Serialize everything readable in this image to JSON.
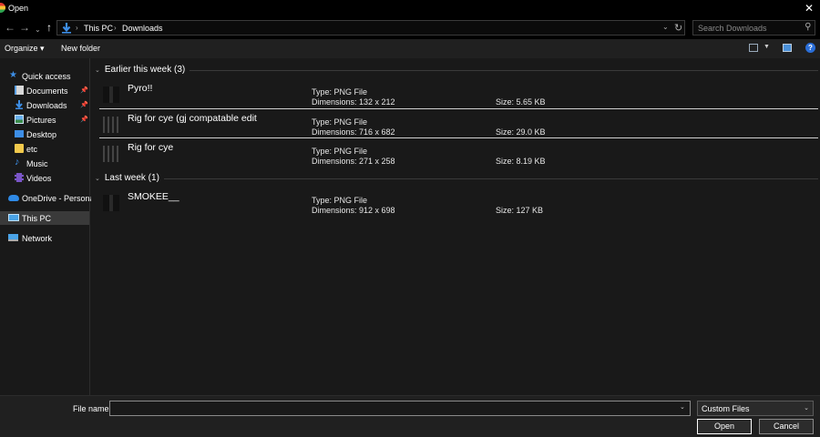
{
  "window": {
    "title": "Open",
    "close_glyph": "✕"
  },
  "address": {
    "crumbs": [
      "This PC",
      "Downloads"
    ],
    "search_placeholder": "Search Downloads"
  },
  "toolbar": {
    "organize": "Organize ▾",
    "new_folder": "New folder",
    "help": "?"
  },
  "sidebar": {
    "items": [
      {
        "label": "Quick access",
        "icon": "star-icon"
      },
      {
        "label": "Documents",
        "icon": "documents-icon",
        "pinned": true
      },
      {
        "label": "Downloads",
        "icon": "download-icon",
        "pinned": true
      },
      {
        "label": "Pictures",
        "icon": "pictures-icon",
        "pinned": true
      },
      {
        "label": "Desktop",
        "icon": "desktop-icon"
      },
      {
        "label": "etc",
        "icon": "folder-icon"
      },
      {
        "label": "Music",
        "icon": "music-icon"
      },
      {
        "label": "Videos",
        "icon": "videos-icon"
      },
      {
        "label": "OneDrive - Personal",
        "icon": "cloud-icon"
      },
      {
        "label": "This PC",
        "icon": "computer-icon",
        "selected": true
      },
      {
        "label": "Network",
        "icon": "network-icon"
      }
    ]
  },
  "groups": [
    {
      "header": "Earlier this week (3)",
      "files": [
        {
          "name": "Pyro!!",
          "type": "Type: PNG File",
          "dimensions": "Dimensions: 132 x 212",
          "size": "Size: 5.65 KB"
        },
        {
          "name": "Rig for cye (gj compatable edit",
          "type": "Type: PNG File",
          "dimensions": "Dimensions: 716 x 682",
          "size": "Size: 29.0 KB"
        },
        {
          "name": "Rig for cye",
          "type": "Type: PNG File",
          "dimensions": "Dimensions: 271 x 258",
          "size": "Size: 8.19 KB"
        }
      ]
    },
    {
      "header": "Last week (1)",
      "files": [
        {
          "name": "SMOKEE__",
          "type": "Type: PNG File",
          "dimensions": "Dimensions: 912 x 698",
          "size": "Size: 127 KB"
        }
      ]
    }
  ],
  "bottom": {
    "file_name_label": "File name:",
    "file_name_value": "",
    "filter": "Custom Files",
    "open": "Open",
    "cancel": "Cancel"
  },
  "colors": {
    "accent": "#2a6ed8",
    "background": "#191919",
    "titlebar": "#000000"
  }
}
